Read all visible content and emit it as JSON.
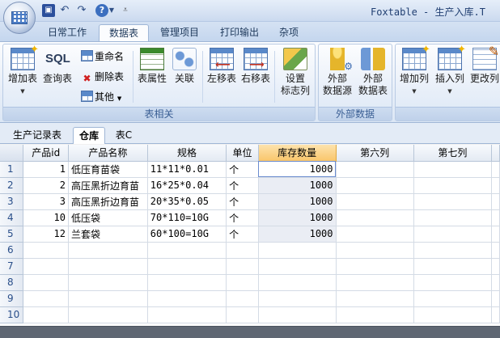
{
  "window": {
    "title": "Foxtable - 生产入库.T"
  },
  "ribbon_tabs": [
    "日常工作",
    "数据表",
    "管理项目",
    "打印输出",
    "杂项"
  ],
  "ribbon": {
    "group_table": {
      "caption": "表相关",
      "add_table": "增加表",
      "query_table": "查询表",
      "sql_icon_text": "SQL",
      "rename": "重命名",
      "delete_table": "删除表",
      "other": "其他",
      "table_props": "表属性",
      "relations": "关联",
      "move_left": "左移表",
      "move_right": "右移表",
      "set_flag_col_1": "设置",
      "set_flag_col_2": "标志列"
    },
    "group_external": {
      "caption": "外部数据",
      "ext_source_1": "外部",
      "ext_source_2": "数据源",
      "ext_table_1": "外部",
      "ext_table_2": "数据表"
    },
    "group_columns": {
      "add_col": "增加列",
      "insert_col": "插入列",
      "rename_col": "更改列"
    }
  },
  "doc_tabs": [
    "生产记录表",
    "仓库",
    "表C"
  ],
  "table": {
    "columns": [
      "产品id",
      "产品名称",
      "规格",
      "单位",
      "库存数量",
      "第六列",
      "第七列"
    ],
    "rows": [
      {
        "n": "1",
        "id": "1",
        "name": "低压育苗袋",
        "spec": "11*11*0.01",
        "unit": "个",
        "qty": "1000"
      },
      {
        "n": "2",
        "id": "2",
        "name": "高压黑折边育苗",
        "spec": "16*25*0.04",
        "unit": "个",
        "qty": "1000"
      },
      {
        "n": "3",
        "id": "3",
        "name": "高压黑折边育苗",
        "spec": "20*35*0.05",
        "unit": "个",
        "qty": "1000"
      },
      {
        "n": "4",
        "id": "10",
        "name": "低压袋",
        "spec": "70*110=10G",
        "unit": "个",
        "qty": "1000"
      },
      {
        "n": "5",
        "id": "12",
        "name": "兰套袋",
        "spec": "60*100=10G",
        "unit": "个",
        "qty": "1000"
      }
    ],
    "empty_row_numbers": [
      "6",
      "7",
      "8",
      "9",
      "10"
    ]
  }
}
